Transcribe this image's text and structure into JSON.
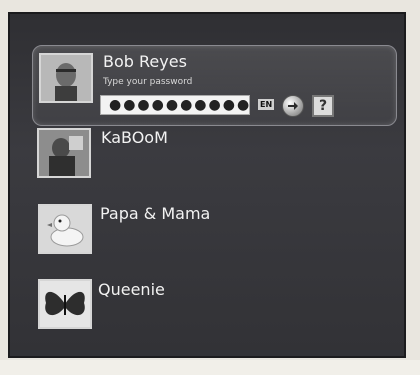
{
  "users": [
    {
      "name": "Bob Reyes",
      "avatar_icon": "man-photo-icon",
      "selected": true
    },
    {
      "name": "KaBOoM",
      "avatar_icon": "child-photo-icon",
      "selected": false
    },
    {
      "name": "Papa & Mama",
      "avatar_icon": "rubber-duck-icon",
      "selected": false
    },
    {
      "name": "Queenie",
      "avatar_icon": "butterfly-icon",
      "selected": false
    }
  ],
  "login": {
    "hint": "Type your password",
    "password_mask": "●●●●●●●●●●",
    "language": "EN",
    "help_label": "?"
  },
  "colors": {
    "panel_bg": "#36363a",
    "text": "#f2f2f2",
    "accent": "#8a8a90"
  }
}
